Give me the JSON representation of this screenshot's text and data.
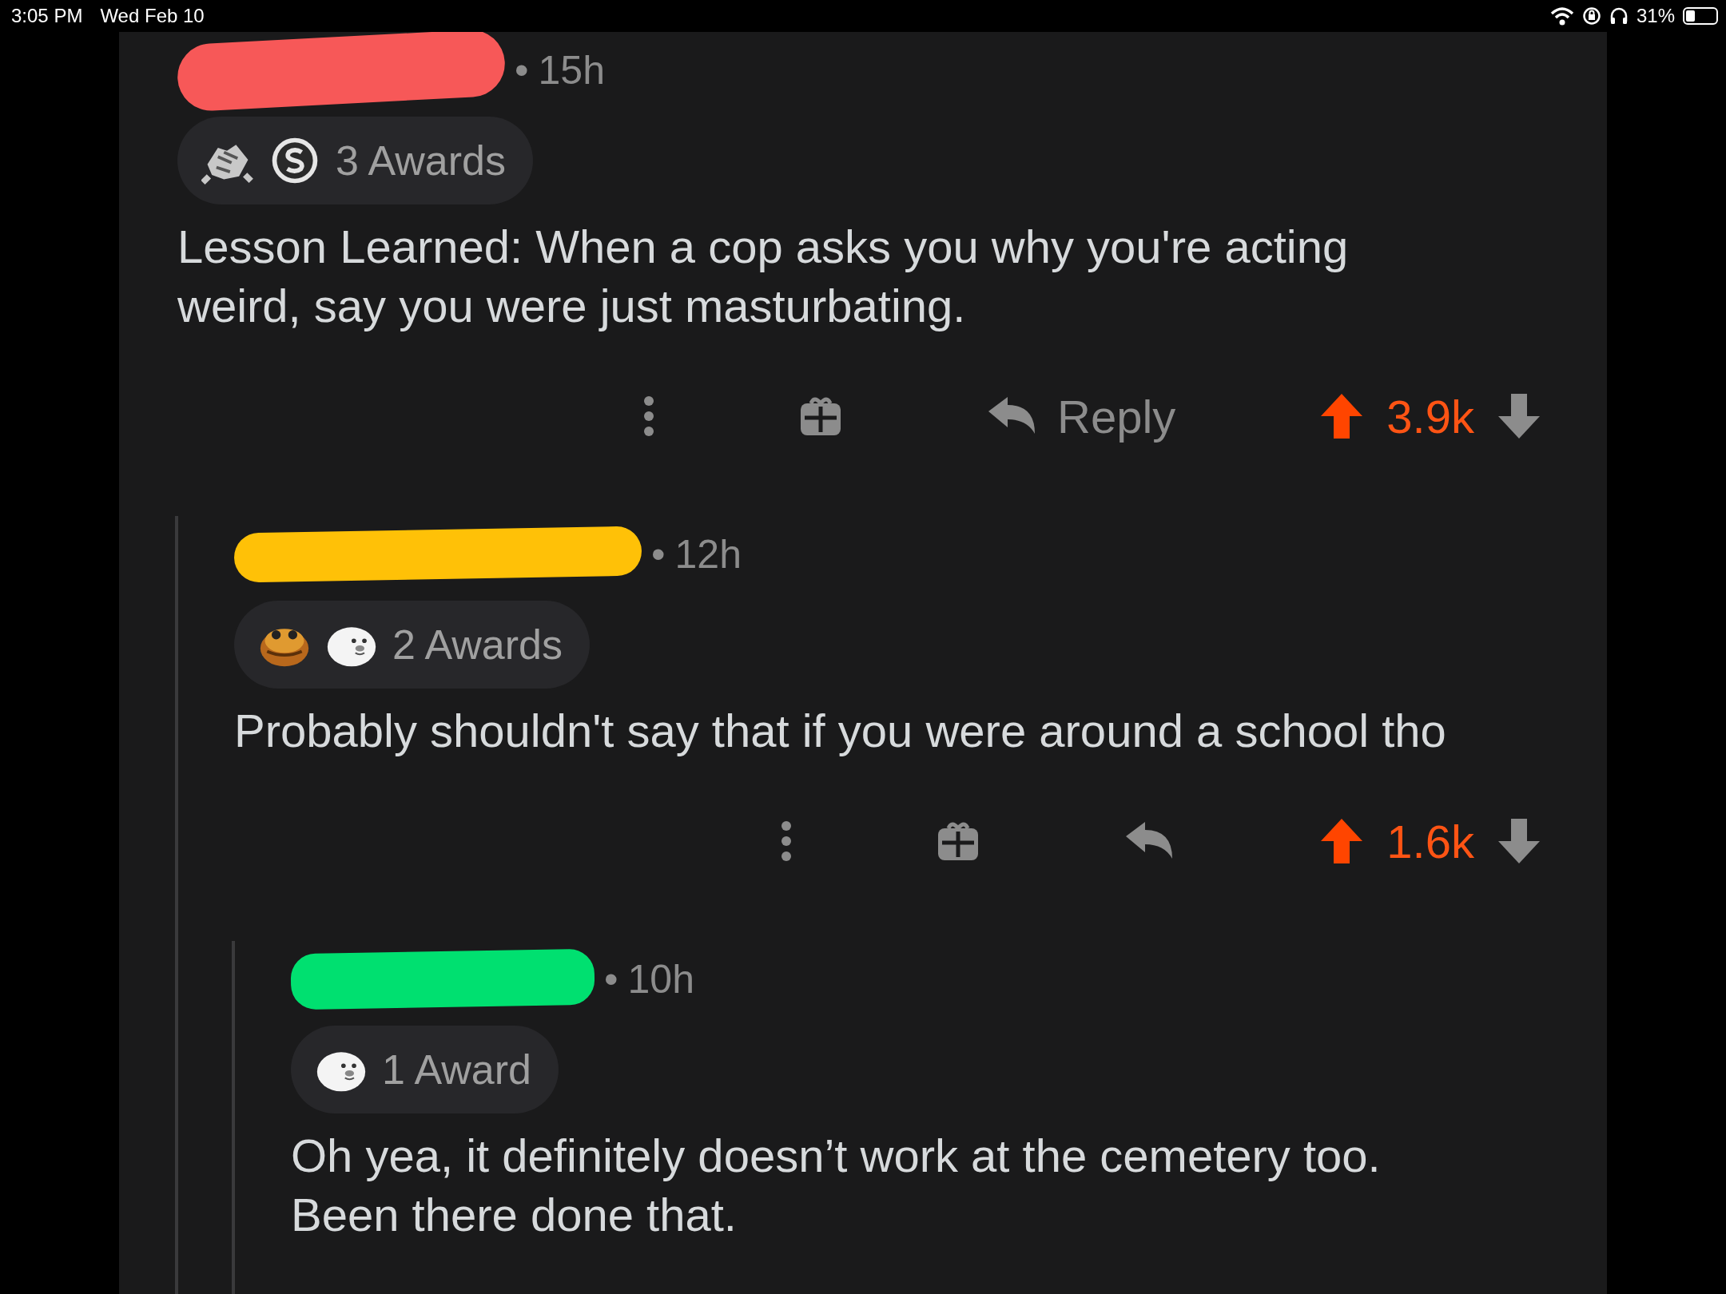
{
  "status_bar": {
    "time": "3:05 PM",
    "date": "Wed Feb 10",
    "battery": "31%"
  },
  "comment": {
    "redaction": {
      "color": "#f75858"
    },
    "separator": "•",
    "age": "15h",
    "awards": [
      {
        "kind": "handshake"
      },
      {
        "kind": "silver"
      }
    ],
    "awards_label": "3 Awards",
    "body": "Lesson Learned: When a cop asks you why you're acting weird, say you were just masturbating.",
    "actions": {
      "reply_label": "Reply",
      "score": "3.9k",
      "upvoted": true
    },
    "children": [
      {
        "redaction": {
          "color": "#ffc107"
        },
        "separator": "•",
        "age": "12h",
        "awards": [
          {
            "kind": "toad"
          },
          {
            "kind": "seal"
          }
        ],
        "awards_label": "2 Awards",
        "body": "Probably shouldn't say that if you were around a school tho",
        "actions": {
          "score": "1.6k",
          "upvoted": true
        },
        "children": [
          {
            "redaction": {
              "color": "#00e070"
            },
            "separator": "•",
            "age": "10h",
            "awards": [
              {
                "kind": "seal"
              }
            ],
            "awards_label": "1 Award",
            "body": "Oh yea, it definitely doesn’t work at the cemetery too. Been there done that."
          }
        ]
      }
    ]
  }
}
